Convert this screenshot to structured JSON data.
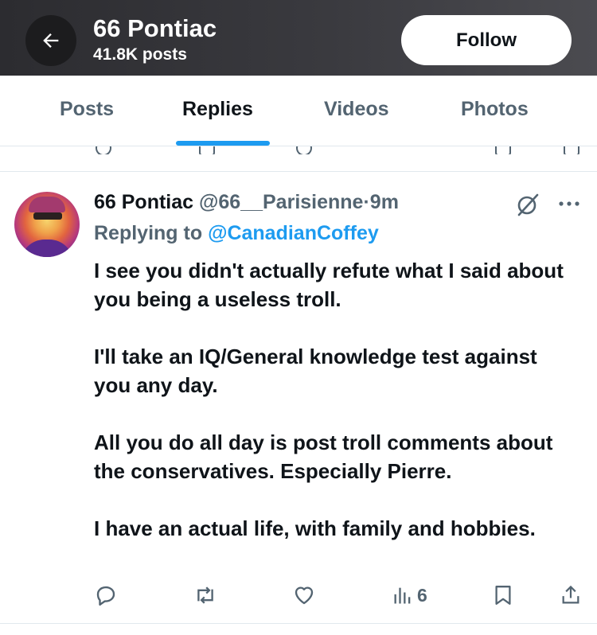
{
  "header": {
    "name": "66 Pontiac",
    "posts_count": "41.8K posts",
    "follow_label": "Follow"
  },
  "tabs": [
    {
      "label": "Posts",
      "active": false
    },
    {
      "label": "Replies",
      "active": true
    },
    {
      "label": "Videos",
      "active": false
    },
    {
      "label": "Photos",
      "active": false
    }
  ],
  "tweet": {
    "display_name": "66 Pontiac",
    "handle": "@66__Parisienne",
    "separator": "·",
    "time": "9m",
    "replying_prefix": "Replying to",
    "replying_to": "@CanadianCoffey",
    "paragraphs": [
      "I see you didn't actually refute what I said about you being a useless troll.",
      "I'll take an IQ/General knowledge test against you any day.",
      "All you do all day is post troll comments about the conservatives. Especially Pierre.",
      "I have an actual life, with family and hobbies."
    ],
    "views": "6"
  },
  "icons": {
    "back": "arrow-left-icon",
    "grok": "grok-icon",
    "more": "more-dots-icon",
    "reply": "reply-icon",
    "repost": "repost-icon",
    "like": "heart-icon",
    "views": "views-icon",
    "bookmark": "bookmark-icon",
    "share": "share-icon"
  },
  "colors": {
    "accent": "#1d9bf0",
    "text": "#0f1419",
    "secondary": "#536471"
  }
}
